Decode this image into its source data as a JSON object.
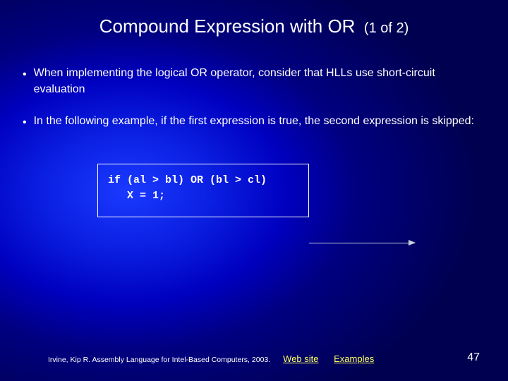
{
  "title": {
    "main": "Compound Expression with OR",
    "suffix": "(1 of 2)"
  },
  "bullets": [
    "When implementing the logical OR operator, consider that HLLs use short-circuit evaluation",
    "In the following example, if the first expression is true, the second expression is skipped:"
  ],
  "code": "if (al > bl) OR (bl > cl)\n   X = 1;",
  "footer": {
    "citation": "Irvine, Kip R. Assembly Language for Intel-Based Computers, 2003.",
    "links": [
      {
        "label": "Web site"
      },
      {
        "label": "Examples"
      }
    ]
  },
  "page_number": "47"
}
